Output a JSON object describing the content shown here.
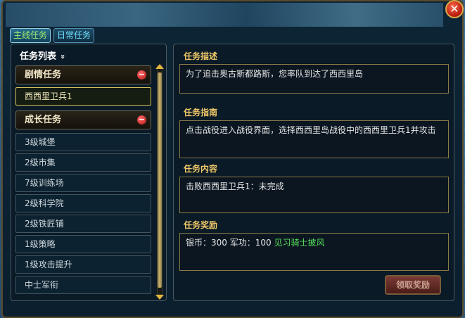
{
  "tabs": [
    {
      "label": "主线任务"
    },
    {
      "label": "日常任务"
    }
  ],
  "close_label": "✕",
  "task_list": {
    "header": "任务列表",
    "header_icon": "»",
    "categories": [
      {
        "label": "剧情任务",
        "toggle": "−"
      },
      {
        "label": "成长任务",
        "toggle": "−"
      }
    ],
    "story_items": [
      "西西里卫兵1"
    ],
    "growth_items": [
      "3级城堡",
      "2级市集",
      "7级训练场",
      "2级科学院",
      "2级铁匠铺",
      "1级策略",
      "1级攻击提升",
      "中士军衔"
    ]
  },
  "detail": {
    "desc_title": "任务描述",
    "desc_text": "为了追击奥古斯都路斯，您率队到达了西西里岛",
    "guide_title": "任务指南",
    "guide_text": "点击战役进入战役界面，选择西西里岛战役中的西西里卫兵1并攻击",
    "content_title": "任务内容",
    "content_text": "击败西西里卫兵1：未完成",
    "reward_title": "任务奖励",
    "reward_text": "银币：300 军功：100",
    "reward_item": "见习骑士披风",
    "claim_button": "领取奖励"
  },
  "colors": {
    "accent": "#f0c868",
    "reward_item": "#57e05a",
    "tab_active": "#9ff06c"
  }
}
